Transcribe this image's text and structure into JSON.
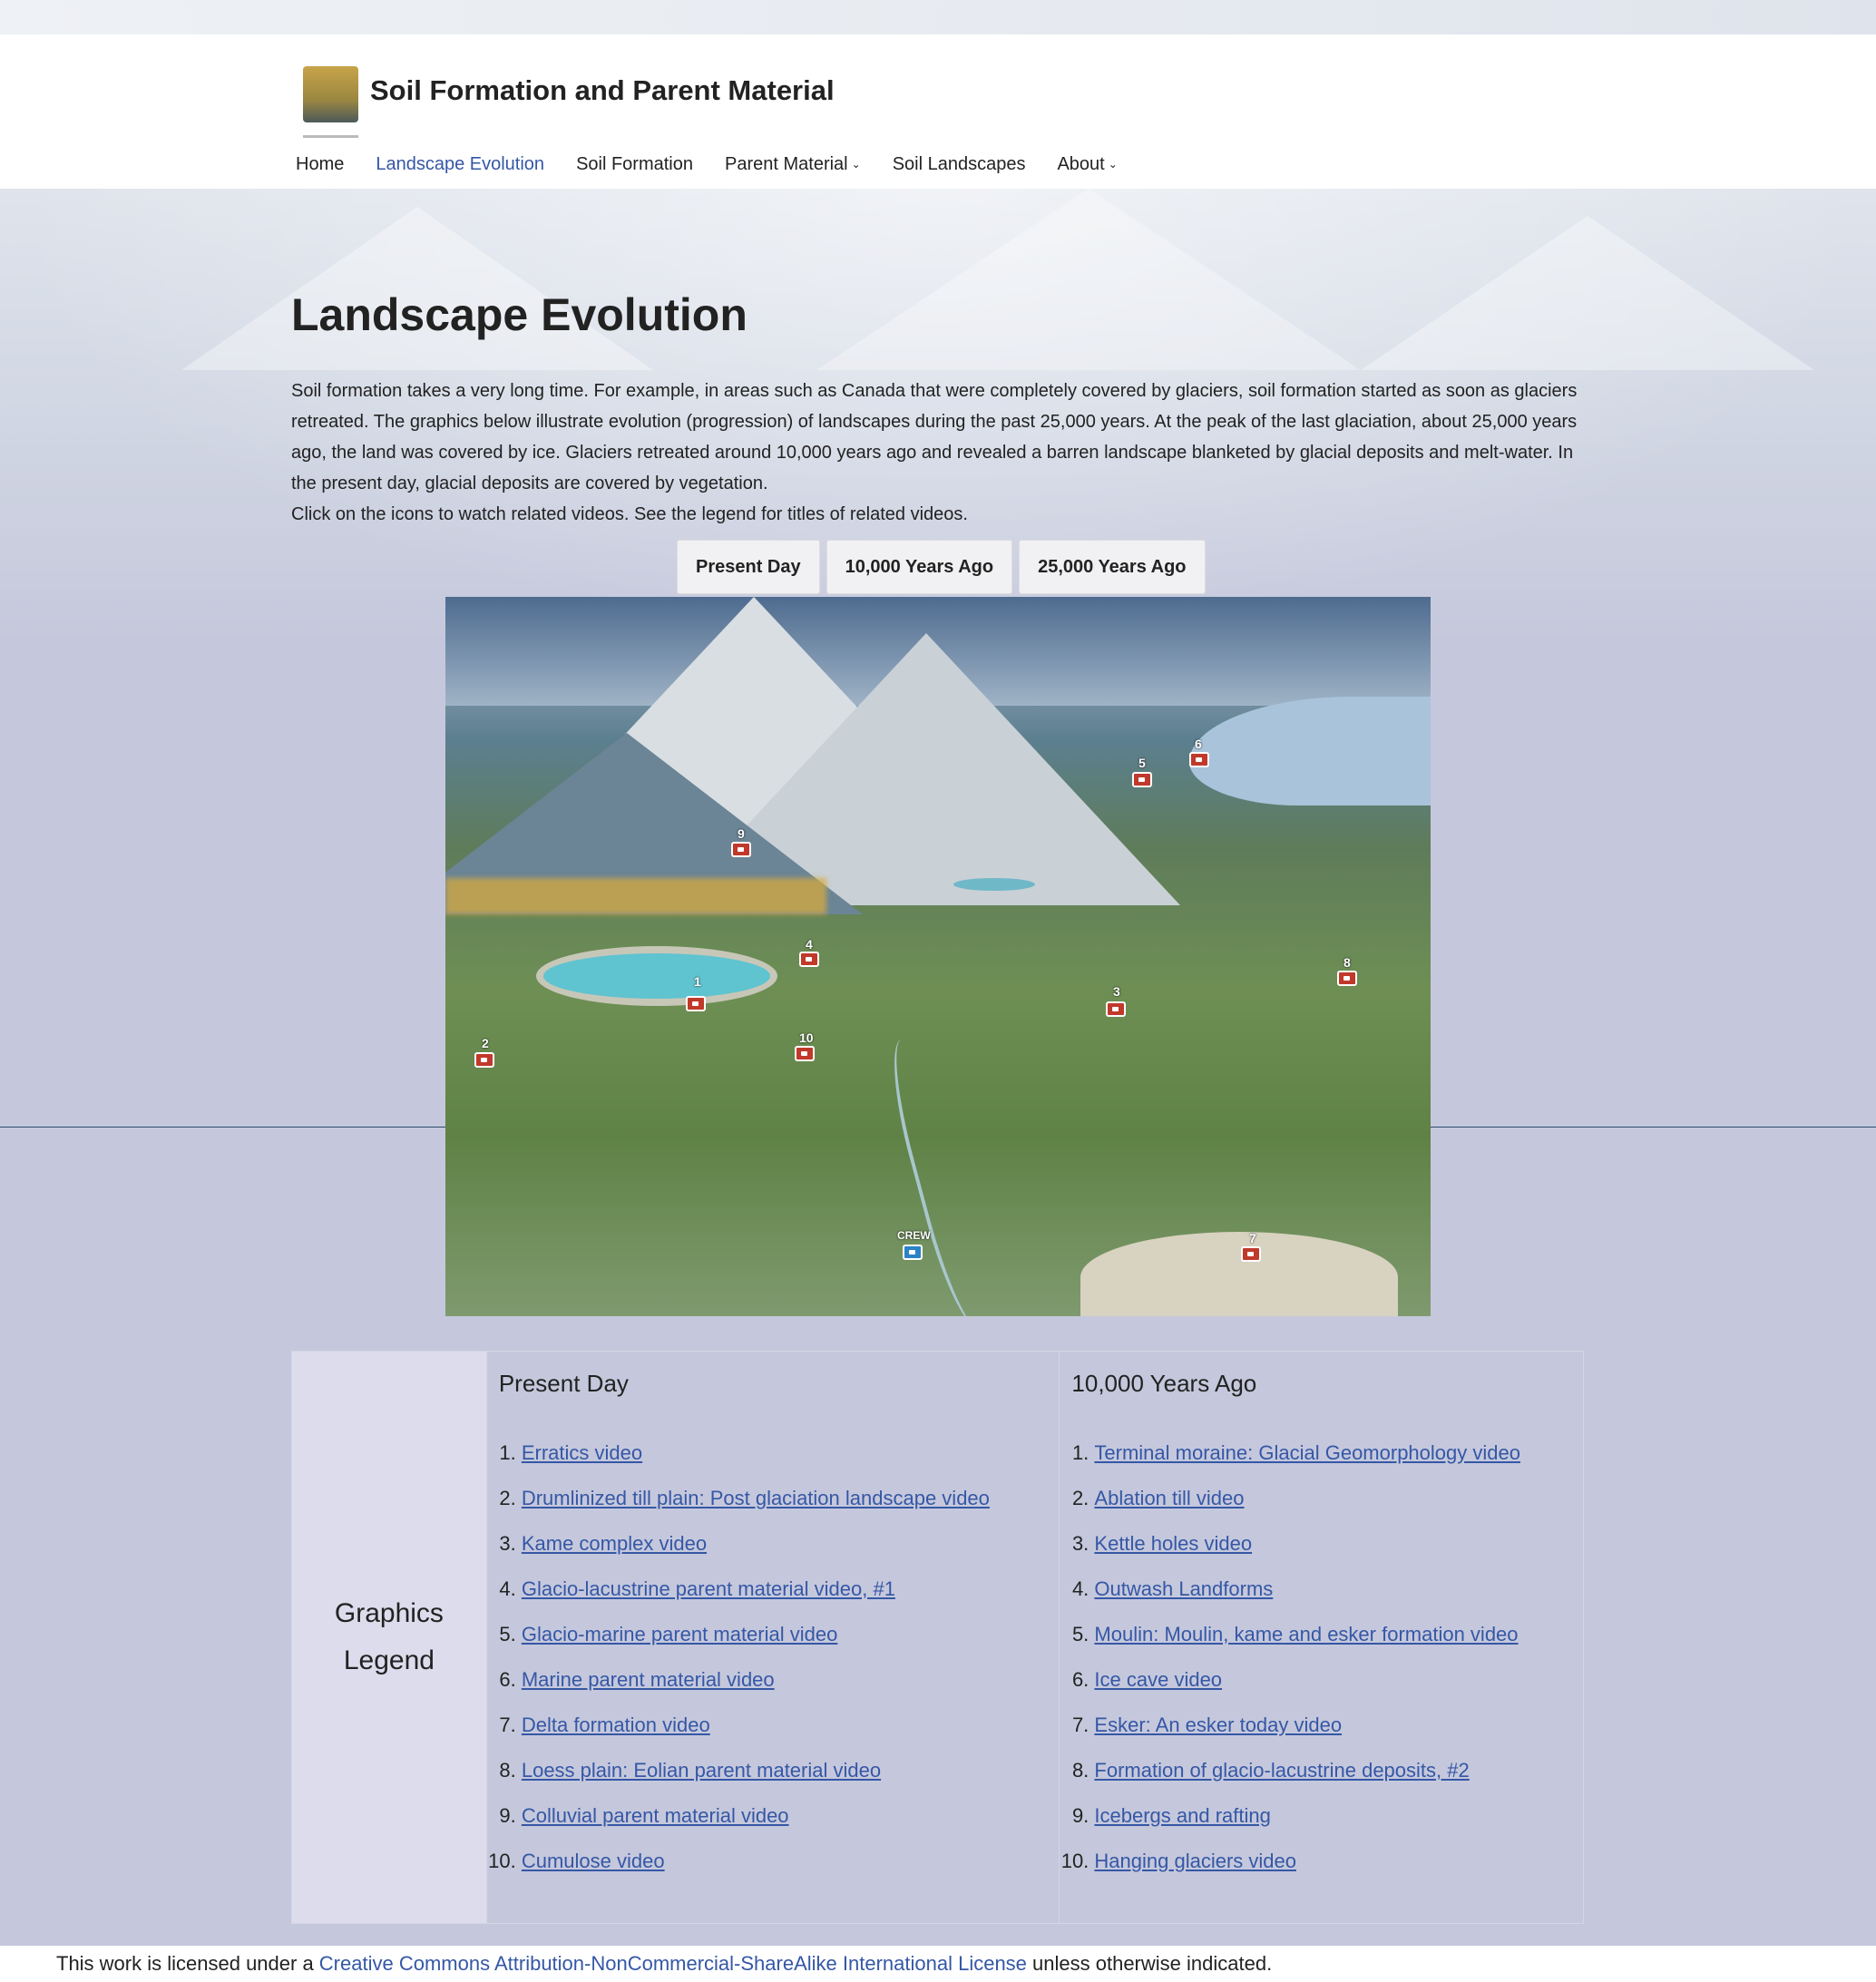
{
  "site": {
    "title": "Soil Formation and Parent Material"
  },
  "nav": {
    "items": [
      {
        "label": "Home",
        "active": false,
        "dropdown": false
      },
      {
        "label": "Landscape Evolution",
        "active": true,
        "dropdown": false
      },
      {
        "label": "Soil Formation",
        "active": false,
        "dropdown": false
      },
      {
        "label": "Parent Material",
        "active": false,
        "dropdown": true
      },
      {
        "label": "Soil Landscapes",
        "active": false,
        "dropdown": false
      },
      {
        "label": "About",
        "active": false,
        "dropdown": true
      }
    ]
  },
  "page": {
    "title": "Landscape Evolution",
    "intro": "Soil formation takes a very long time. For example, in areas such as Canada that were completely covered by glaciers, soil formation started as soon as glaciers retreated. The graphics below illustrate evolution (progression) of landscapes during the past 25,000 years. At the peak of the last glaciation, about 25,000 years ago, the land was covered by ice. Glaciers retreated around 10,000 years ago and revealed a barren landscape blanketed by glacial deposits and melt-water. In the present day, glacial deposits are covered by vegetation.",
    "instruction": "Click on the icons to watch related videos. See the legend for titles of related videos."
  },
  "tabs": [
    "Present Day",
    "10,000 Years Ago",
    "25,000 Years Ago"
  ],
  "scene": {
    "markers": [
      "1",
      "2",
      "3",
      "4",
      "5",
      "6",
      "7",
      "8",
      "9",
      "10",
      "CREW"
    ],
    "colors": {
      "marker": "#c0392b",
      "crew_marker": "#2b82c6"
    }
  },
  "legend": {
    "heading_line1": "Graphics",
    "heading_line2": "Legend",
    "present": {
      "title": "Present Day",
      "items": [
        "Erratics video",
        "Drumlinized till plain: Post glaciation landscape video",
        "Kame complex video",
        "Glacio-lacustrine parent material video, #1",
        "Glacio-marine parent material video",
        "Marine parent material video",
        "Delta formation video",
        "Loess plain: Eolian parent material video",
        "Colluvial parent material video",
        "Cumulose video"
      ]
    },
    "past": {
      "title": "10,000 Years Ago",
      "items": [
        "Terminal moraine: Glacial Geomorphology video",
        "Ablation till video",
        "Kettle holes video",
        "Outwash Landforms",
        "Moulin: Moulin, kame and esker formation video",
        "Ice cave video",
        "Esker: An esker today video",
        "Formation of glacio-lacustrine deposits, #2",
        "Icebergs and rafting",
        "Hanging glaciers video"
      ]
    }
  },
  "footer": {
    "prefix": "This work is licensed under a ",
    "link": "Creative Commons Attribution-NonCommercial-ShareAlike International License",
    "suffix": " unless otherwise indicated."
  },
  "colors": {
    "link": "#3557a6",
    "legend_head_bg": "#dcdcec",
    "page_bg": "#c5c8dc"
  }
}
